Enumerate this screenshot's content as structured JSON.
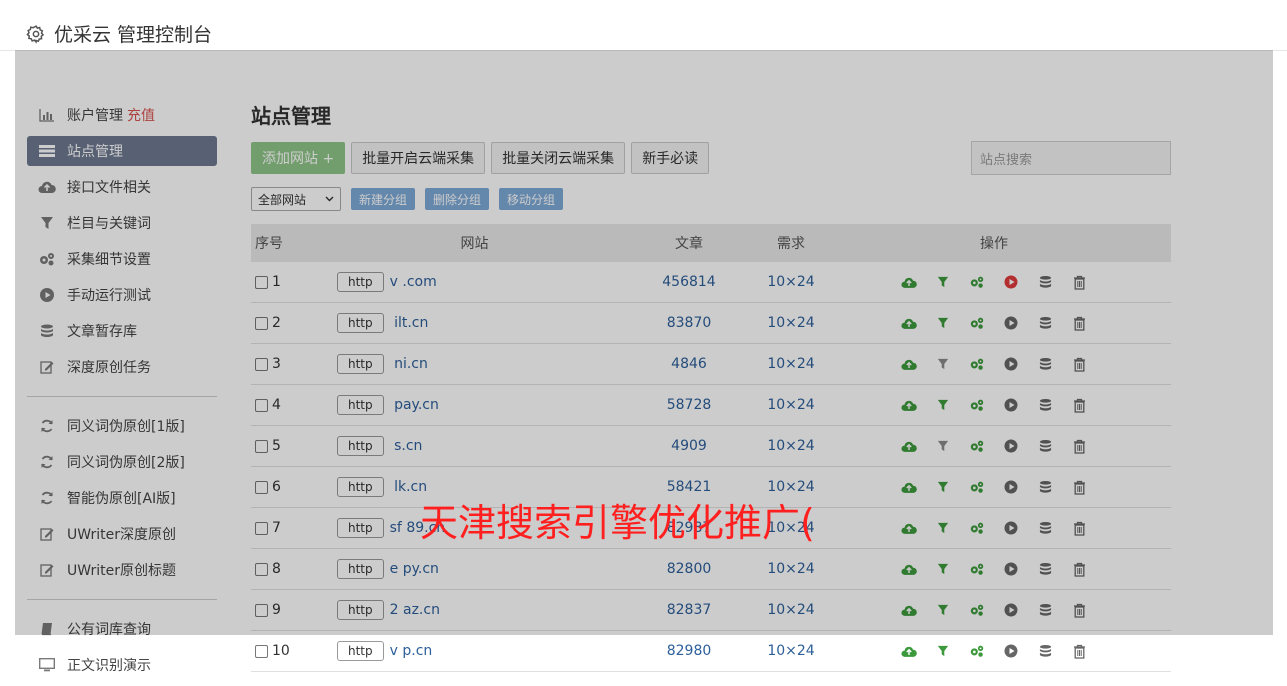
{
  "header": {
    "title": "优采云 管理控制台"
  },
  "sidebar": {
    "items": [
      {
        "label": "账户管理",
        "badge": "充值",
        "icon": "bar-chart-icon"
      },
      {
        "label": "站点管理",
        "icon": "list-icon",
        "active": true
      },
      {
        "label": "接口文件相关",
        "icon": "cloud-upload-icon"
      },
      {
        "label": "栏目与关键词",
        "icon": "filter-icon"
      },
      {
        "label": "采集细节设置",
        "icon": "cogs-icon"
      },
      {
        "label": "手动运行测试",
        "icon": "play-icon"
      },
      {
        "label": "文章暂存库",
        "icon": "database-icon"
      },
      {
        "label": "深度原创任务",
        "icon": "edit-icon"
      }
    ],
    "items2": [
      {
        "label": "同义词伪原创[1版]",
        "icon": "refresh-icon"
      },
      {
        "label": "同义词伪原创[2版]",
        "icon": "refresh-icon"
      },
      {
        "label": "智能伪原创[AI版]",
        "icon": "refresh-icon"
      },
      {
        "label": "UWriter深度原创",
        "icon": "edit-icon"
      },
      {
        "label": "UWriter原创标题",
        "icon": "edit-icon"
      }
    ],
    "items3": [
      {
        "label": "公有词库查询",
        "icon": "book-icon"
      },
      {
        "label": "正文识别演示",
        "icon": "monitor-icon"
      }
    ]
  },
  "main": {
    "title": "站点管理",
    "buttons": {
      "add": "添加网站 +",
      "batch_on": "批量开启云端采集",
      "batch_off": "批量关闭云端采集",
      "guide": "新手必读"
    },
    "search_placeholder": "站点搜索",
    "filter": {
      "select_value": "全部网站",
      "new_group": "新建分组",
      "delete_group": "删除分组",
      "move_group": "移动分组"
    },
    "table": {
      "headers": [
        "序号",
        "网站",
        "文章",
        "需求",
        "操作"
      ],
      "rows": [
        {
          "no": "1",
          "scheme": "http",
          "domain": "v            .com",
          "articles": "456814",
          "req": "10×24",
          "play_active": true,
          "filter_active": true
        },
        {
          "no": "2",
          "scheme": "http",
          "domain": "     ilt.cn",
          "articles": "83870",
          "req": "10×24",
          "play_active": false,
          "filter_active": true
        },
        {
          "no": "3",
          "scheme": "http",
          "domain": "     ni.cn",
          "articles": "4846",
          "req": "10×24",
          "play_active": false,
          "filter_active": false
        },
        {
          "no": "4",
          "scheme": "http",
          "domain": "     pay.cn",
          "articles": "58728",
          "req": "10×24",
          "play_active": false,
          "filter_active": true
        },
        {
          "no": "5",
          "scheme": "http",
          "domain": "       s.cn",
          "articles": "4909",
          "req": "10×24",
          "play_active": false,
          "filter_active": false
        },
        {
          "no": "6",
          "scheme": "http",
          "domain": "     lk.cn",
          "articles": "58421",
          "req": "10×24",
          "play_active": false,
          "filter_active": true
        },
        {
          "no": "7",
          "scheme": "http",
          "domain": "sf  89.cn",
          "articles": "82987",
          "req": "10×24",
          "play_active": false,
          "filter_active": true
        },
        {
          "no": "8",
          "scheme": "http",
          "domain": "e     py.cn",
          "articles": "82800",
          "req": "10×24",
          "play_active": false,
          "filter_active": true
        },
        {
          "no": "9",
          "scheme": "http",
          "domain": "2     az.cn",
          "articles": "82837",
          "req": "10×24",
          "play_active": false,
          "filter_active": true
        },
        {
          "no": "10",
          "scheme": "http",
          "domain": "v     p.cn",
          "articles": "82980",
          "req": "10×24",
          "play_active": false,
          "filter_active": true
        }
      ]
    }
  },
  "watermark": "天津搜索引擎优化推广(",
  "colors": {
    "accent_green": "#8fc689",
    "sidebar_active": "#6d7a90",
    "link_blue": "#2d5f9a",
    "play_red": "#e03a3a",
    "tag_blue": "#7da9d8"
  }
}
